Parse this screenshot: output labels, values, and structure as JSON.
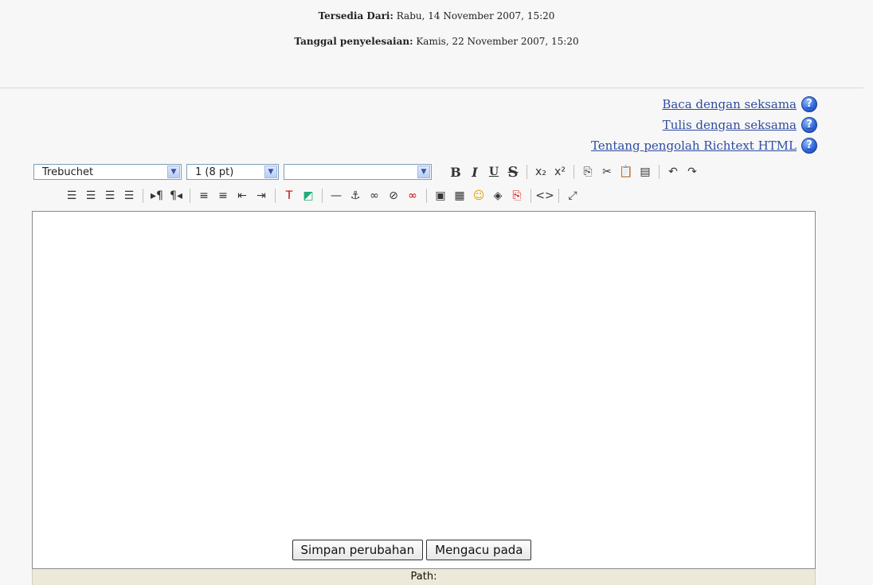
{
  "dates": {
    "available_label": "Tersedia Dari:",
    "available_value": "Rabu, 14 November 2007, 15:20",
    "due_label": "Tanggal penyelesaian:",
    "due_value": "Kamis, 22 November 2007, 15:20"
  },
  "help_links": [
    "Baca dengan seksama",
    "Tulis dengan seksama",
    "Tentang pengolah Richtext HTML"
  ],
  "toolbar": {
    "font_family": "Trebuchet",
    "font_size": "1 (8 pt)",
    "heading": "",
    "bold": "B",
    "italic": "I",
    "underline": "U",
    "strike": "S"
  },
  "editor": {
    "content": "",
    "path_label": "Path:"
  },
  "actions": {
    "save": "Simpan perubahan",
    "revert": "Mengacu pada"
  }
}
